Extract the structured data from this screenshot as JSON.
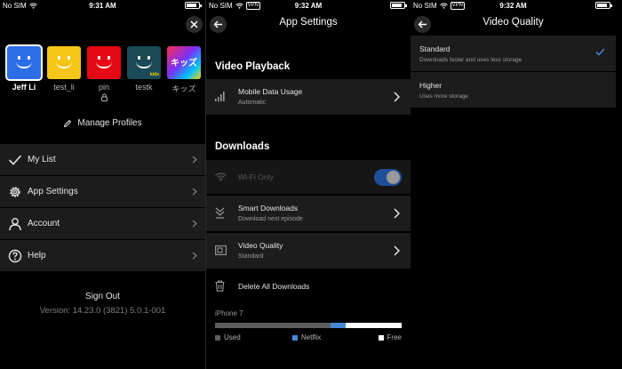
{
  "status": {
    "carrier": "No SIM",
    "vpn": "VPN",
    "times": [
      "9:31 AM",
      "9:32 AM",
      "9:32 AM"
    ]
  },
  "colors": {
    "background": "#000000",
    "row": "#1c1c1c",
    "accent_blue": "#4687d6",
    "toggle_on": "#1f4f9a"
  },
  "profiles_screen": {
    "profiles": [
      {
        "name": "Jeff Li",
        "color": "#2b6de6",
        "selected": true,
        "icon": "smile-avatar"
      },
      {
        "name": "test_li",
        "color": "#f5c518",
        "selected": false,
        "icon": "smile-avatar"
      },
      {
        "name": "pin",
        "color": "#e50914",
        "selected": false,
        "icon": "smile-avatar",
        "locked": true
      },
      {
        "name": "testk",
        "color": "#1b4a57",
        "selected": false,
        "icon": "smile-avatar",
        "kids_label": "kids"
      },
      {
        "name": "キッズ",
        "color": "#7b2ff7",
        "selected": false,
        "icon": "kids-avatar",
        "avatar_text": "キッズ"
      }
    ],
    "manage_profiles": "Manage Profiles",
    "menu": [
      {
        "label": "My List",
        "icon": "check-icon"
      },
      {
        "label": "App Settings",
        "icon": "gear-icon"
      },
      {
        "label": "Account",
        "icon": "person-icon"
      },
      {
        "label": "Help",
        "icon": "help-icon"
      }
    ],
    "sign_out": "Sign Out",
    "version": "Version: 14.23.0 (3821) 5.0.1-001"
  },
  "app_settings": {
    "title": "App Settings",
    "video_playback_header": "Video Playback",
    "mobile_data": {
      "label": "Mobile Data Usage",
      "value": "Automatic"
    },
    "downloads_header": "Downloads",
    "wifi_only": {
      "label": "Wi-Fi Only",
      "on": true
    },
    "smart_downloads": {
      "label": "Smart Downloads",
      "value": "Download next episode"
    },
    "video_quality": {
      "label": "Video Quality",
      "value": "Standard"
    },
    "delete_all": "Delete All Downloads",
    "storage": {
      "device": "iPhone 7",
      "used_fraction": 0.62,
      "netflix_fraction": 0.08,
      "legend": [
        {
          "label": "Used",
          "color": "#5e5e5e"
        },
        {
          "label": "Netflix",
          "color": "#4687d6"
        },
        {
          "label": "Free",
          "color": "#ffffff"
        }
      ]
    }
  },
  "video_quality": {
    "title": "Video Quality",
    "options": [
      {
        "label": "Standard",
        "desc": "Downloads faster and uses less storage",
        "selected": true
      },
      {
        "label": "Higher",
        "desc": "Uses more storage",
        "selected": false
      }
    ]
  }
}
